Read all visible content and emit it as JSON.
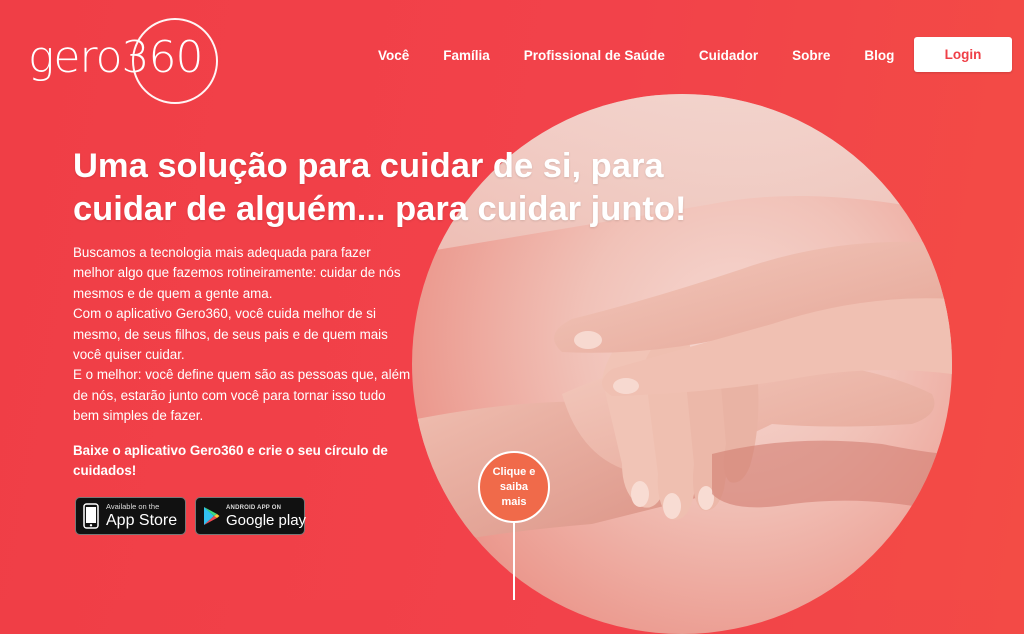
{
  "brand": {
    "logo_text": "gero360"
  },
  "nav": {
    "items": [
      {
        "label": "Você"
      },
      {
        "label": "Família"
      },
      {
        "label": "Profissional de Saúde"
      },
      {
        "label": "Cuidador"
      },
      {
        "label": "Sobre"
      },
      {
        "label": "Blog"
      }
    ],
    "login_label": "Login"
  },
  "hero": {
    "headline_line1": "Uma solução para cuidar de si, para",
    "headline_line2": "cuidar de alguém... para cuidar junto!",
    "paragraphs": [
      "Buscamos a tecnologia mais adequada para fazer melhor algo que fazemos rotineiramente: cuidar de nós mesmos e de quem a gente ama.",
      "Com o aplicativo Gero360, você cuida melhor de si mesmo, de seus filhos, de seus pais e de quem mais você quiser cuidar.",
      "E o melhor: você define quem são as pessoas que, além de nós, estarão junto com você para tornar isso tudo bem simples de fazer."
    ],
    "cta": "Baixe o aplicativo Gero360 e crie o seu círculo de cuidados!",
    "click_label": "Clique e saiba mais"
  },
  "stores": {
    "appstore": {
      "small": "Available on the",
      "big": "App Store",
      "icon": "iphone-icon"
    },
    "google": {
      "small": "ANDROID APP ON",
      "big": "Google play",
      "icon": "google-play-icon"
    }
  },
  "colors": {
    "background": "#f2424a",
    "accent": "#ef3f47",
    "click_circle": "#f06a4a"
  }
}
